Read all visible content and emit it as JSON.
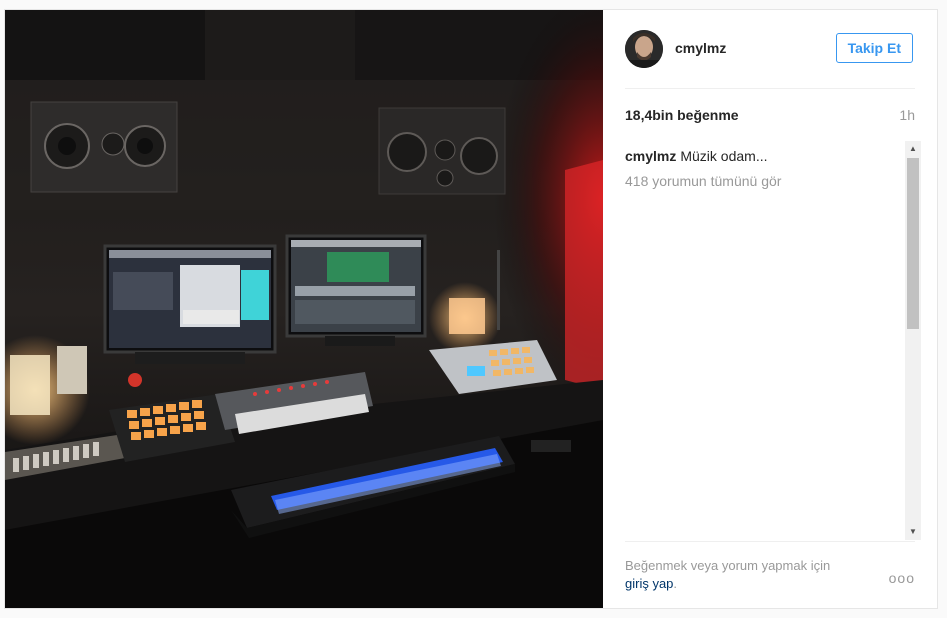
{
  "post": {
    "image_alt": "Music studio with monitors, speakers and keyboards",
    "author": {
      "username": "cmylmz",
      "avatar": "avatar-photo"
    },
    "follow_label": "Takip Et",
    "likes": "18,4bin beğenme",
    "time": "1h",
    "caption": {
      "username": "cmylmz",
      "text": "Müzik odam..."
    },
    "view_all_comments": "418 yorumun tümünü gör",
    "login_prompt": "Beğenmek veya yorum yapmak için",
    "login_link": "giriş yap",
    "login_period": ".",
    "more_icon": "ellipsis-icon",
    "more_label": "ooo"
  },
  "colors": {
    "accent": "#3897f0",
    "link": "#003569",
    "muted": "#999999"
  }
}
